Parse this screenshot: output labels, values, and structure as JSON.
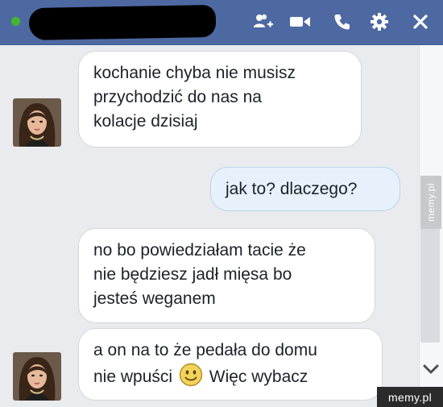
{
  "titlebar": {
    "icons": [
      "add-person-icon",
      "video-icon",
      "phone-icon",
      "gear-icon",
      "close-icon"
    ],
    "colors": {
      "background": "#4e69a2",
      "status_online": "#42b72a"
    }
  },
  "messages": [
    {
      "sender": "contact",
      "lines": [
        "kochanie chyba nie musisz",
        "przychodzić do nas na",
        "kolacje dzisiaj"
      ]
    },
    {
      "sender": "me",
      "lines": [
        "jak to? dlaczego?"
      ]
    },
    {
      "sender": "contact",
      "lines": [
        "no bo powiedziałam tacie że",
        "nie będziesz jadł mięsa bo",
        "jesteś weganem"
      ]
    },
    {
      "sender": "contact",
      "line1": "a on na to że pedała do domu",
      "line2_before": "nie wpuści",
      "line2_after": "Więc wybacz",
      "emoji": "smile-emoji"
    }
  ],
  "watermark": "memy.pl"
}
